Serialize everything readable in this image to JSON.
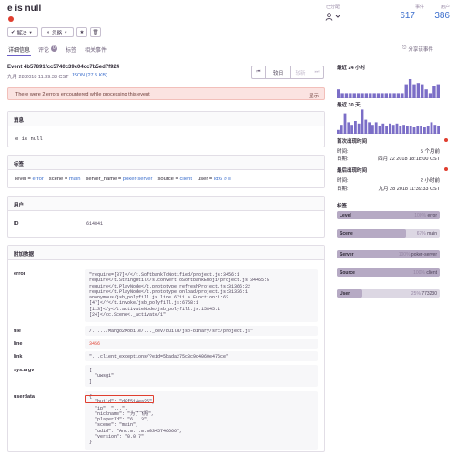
{
  "header": {
    "title": "e is null",
    "assignee_label": "已分配",
    "events_label": "事件",
    "events_count": "617",
    "users_label": "用户",
    "users_count": "386",
    "resolve_label": "解决",
    "ignore_label": "忽略"
  },
  "tabs": [
    {
      "label": "详细信息"
    },
    {
      "label": "评论",
      "badge": "0"
    },
    {
      "label": "标签"
    },
    {
      "label": "相关事件"
    }
  ],
  "share_label": "分享该事件",
  "event": {
    "id": "Event 4b57891fcc5740c39c04cc7b5ed7f924",
    "datetime": "九月 28 2018 11:39:33 CST",
    "json_label": "JSON (27.5 KB)",
    "older_label": "较旧",
    "newer_label": "较新"
  },
  "errors_banner": {
    "text": "There were 2 errors encountered while processing this event",
    "action": "显示"
  },
  "message": {
    "heading": "消息",
    "text": "e is null"
  },
  "tags": {
    "heading": "标签",
    "items": [
      {
        "key": "level",
        "value": "error"
      },
      {
        "key": "scene",
        "value": "main"
      },
      {
        "key": "server_name",
        "value": "poker-server"
      },
      {
        "key": "source",
        "value": "client"
      },
      {
        "key": "user",
        "value": "id:6"
      }
    ]
  },
  "user_section": {
    "heading": "用户",
    "id_label": "ID",
    "id_value": "614841"
  },
  "extra": {
    "heading": "附加数据",
    "error_label": "error",
    "error_lines": [
      "\"require=[37]</</t.SoftbankToNotified/project.js:3456:1",
      "require</t.StringUtil</s.convertToSoftbankEmoji/project.js:34455:8",
      "require</t.PlayNode</t.prototype.refreshProject.js:31366:22",
      "require</t.PlayNode</t.prototype.onload/project.js:31336:1",
      "anonymous/jsb_polyfill.js line 6711 > Function:1:63",
      "[47]</f</t.invoke/jsb_polyfill.js:6758:1",
      "[113]</y</t.activateNode/jsb_polyfill.js:15845:1",
      "[24]</cc.Scene<._activate/1\""
    ],
    "file_label": "file",
    "file_value": "/...../Mango2Mobile/..._dev/build/jsb-binary/src/project.js\"",
    "line_label": "line",
    "line_value": "3456",
    "link_label": "link",
    "link_value": "\"...client_exceptions/?eid=5bada275c8c9d4060e476ce\"",
    "sysargv_label": "sys.argv",
    "sysargv_lines": [
      "[",
      "  \"uwsgi\"",
      "]"
    ],
    "userdata_label": "userdata",
    "userdata_lines": [
      "{",
      "  \"build\": \"d0f514ea25\",",
      "  \"ip\": \"...\",",
      "  \"nickname\": \"为了飞翔\",",
      "  \"playerId\": \"6...3\",",
      "  \"scene\": \"main\",",
      "  \"udid\": \"And.m...m.m0345746666\",",
      "  \"version\": \"0.0.7\"",
      "}"
    ]
  },
  "sidebar": {
    "last24_label": "最近 24 小时",
    "last30_label": "最近 30 天",
    "last24_bars": [
      0.35,
      0.2,
      0.2,
      0.2,
      0.2,
      0.2,
      0.2,
      0.2,
      0.2,
      0.2,
      0.2,
      0.2,
      0.2,
      0.2,
      0.2,
      0.2,
      0.2,
      0.55,
      0.75,
      0.55,
      0.6,
      0.55,
      0.35,
      0.2,
      0.5,
      0.55
    ],
    "last30_bars": [
      0.15,
      0.35,
      0.8,
      0.45,
      0.35,
      0.5,
      0.4,
      0.95,
      0.55,
      0.45,
      0.35,
      0.45,
      0.3,
      0.4,
      0.3,
      0.4,
      0.35,
      0.4,
      0.3,
      0.35,
      0.3,
      0.3,
      0.25,
      0.3,
      0.3,
      0.25,
      0.3,
      0.45,
      0.35,
      0.3
    ],
    "first_seen_label": "首次出现时间",
    "first_time_label": "时间:",
    "first_time_value": "5 个月前",
    "first_date_label": "日期:",
    "first_date_value": "四月 22 2018 18:18:00 CST",
    "last_seen_label": "最后出现时间",
    "last_time_label": "时间:",
    "last_time_value": "2 小时前",
    "last_date_label": "日期:",
    "last_date_value": "九月 28 2018 11:39:33 CST",
    "tags_label": "标签",
    "tag_bars": [
      {
        "name": "Level",
        "value": "error",
        "percent": 100,
        "pct_label": "100%"
      },
      {
        "name": "Scene",
        "value": "main",
        "percent": 67,
        "pct_label": "67%"
      },
      {
        "name": "Server",
        "value": "poker-server",
        "percent": 100,
        "pct_label": "100%"
      },
      {
        "name": "Source",
        "value": "client",
        "percent": 100,
        "pct_label": "100%"
      },
      {
        "name": "User",
        "value": "773230",
        "percent": 25,
        "pct_label": "25%"
      }
    ],
    "accent_color": "#7b6ec7",
    "red_color": "#e03e2f"
  }
}
